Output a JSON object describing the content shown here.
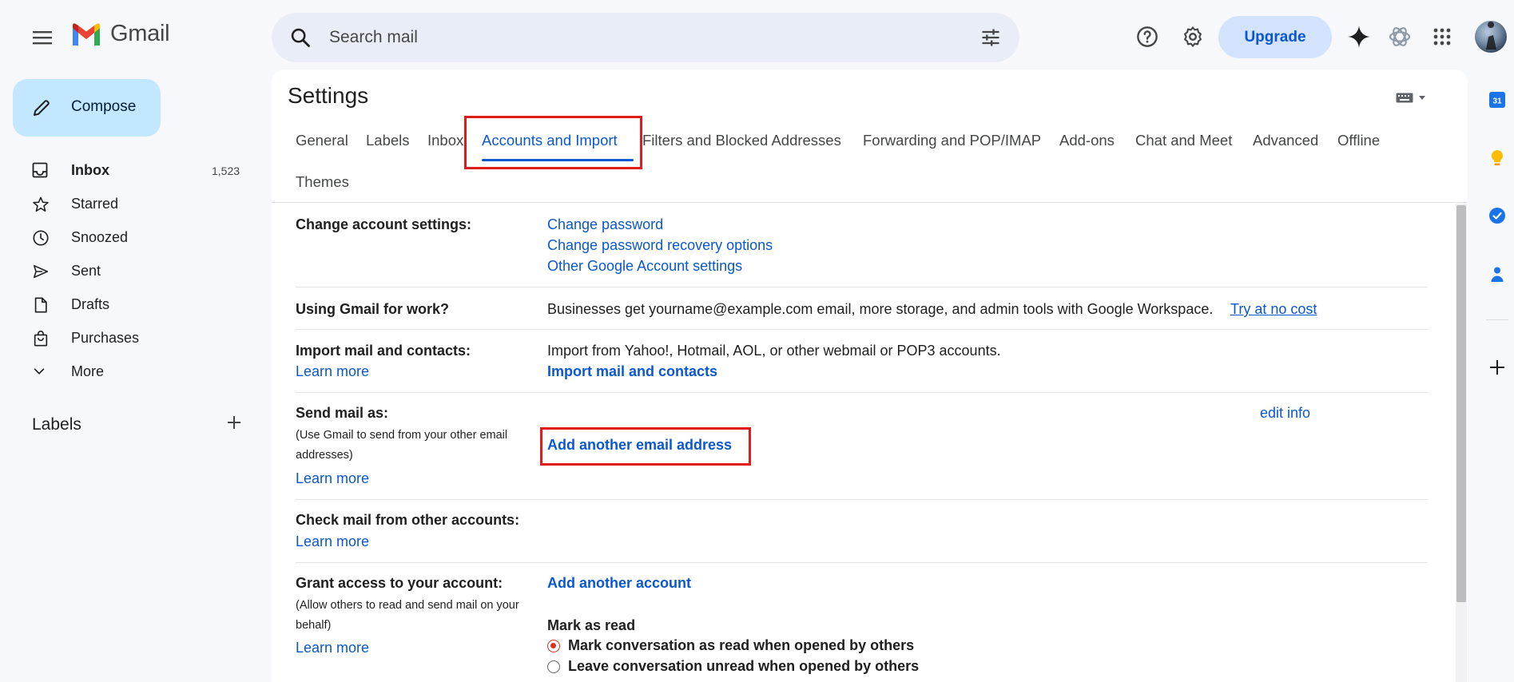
{
  "header": {
    "app_name": "Gmail",
    "search_placeholder": "Search mail",
    "upgrade_label": "Upgrade"
  },
  "nav": {
    "compose_label": "Compose",
    "items": [
      {
        "label": "Inbox",
        "count": "1,523",
        "icon": "inbox-icon"
      },
      {
        "label": "Starred",
        "count": "",
        "icon": "star-icon"
      },
      {
        "label": "Snoozed",
        "count": "",
        "icon": "clock-icon"
      },
      {
        "label": "Sent",
        "count": "",
        "icon": "send-icon"
      },
      {
        "label": "Drafts",
        "count": "",
        "icon": "draft-icon"
      },
      {
        "label": "Purchases",
        "count": "",
        "icon": "shopping-bag-icon"
      },
      {
        "label": "More",
        "count": "",
        "icon": "chevron-down-icon"
      }
    ],
    "labels_heading": "Labels"
  },
  "settings": {
    "title": "Settings",
    "tabs": [
      "General",
      "Labels",
      "Inbox",
      "Accounts and Import",
      "Filters and Blocked Addresses",
      "Forwarding and POP/IMAP",
      "Add-ons",
      "Chat and Meet",
      "Advanced",
      "Offline",
      "Themes"
    ],
    "active_tab": "Accounts and Import",
    "change_account": {
      "label": "Change account settings:",
      "links": [
        "Change password",
        "Change password recovery options",
        "Other Google Account settings"
      ]
    },
    "work": {
      "label": "Using Gmail for work?",
      "text": "Businesses get yourname@example.com email, more storage, and admin tools with Google Workspace.",
      "link": "Try at no cost"
    },
    "import": {
      "label": "Import mail and contacts:",
      "learn_more": "Learn more",
      "text": "Import from Yahoo!, Hotmail, AOL, or other webmail or POP3 accounts.",
      "action": "Import mail and contacts"
    },
    "send_as": {
      "label": "Send mail as:",
      "sub": "(Use Gmail to send from your other email addresses)",
      "learn_more": "Learn more",
      "edit": "edit info",
      "action": "Add another email address"
    },
    "check_mail": {
      "label": "Check mail from other accounts:",
      "learn_more": "Learn more"
    },
    "grant": {
      "label": "Grant access to your account:",
      "sub": "(Allow others to read and send mail on your behalf)",
      "learn_more": "Learn more",
      "action": "Add another account",
      "mark_heading": "Mark as read",
      "options": [
        "Mark conversation as read when opened by others",
        "Leave conversation unread when opened by others"
      ],
      "selected_option": 0
    }
  },
  "side_panel": {
    "calendar_day": "31"
  },
  "colors": {
    "accent": "#0b57d0",
    "highlight": "#e01b1b",
    "compose_bg": "#c2e7ff",
    "upgrade_bg": "#d3e3fd"
  }
}
